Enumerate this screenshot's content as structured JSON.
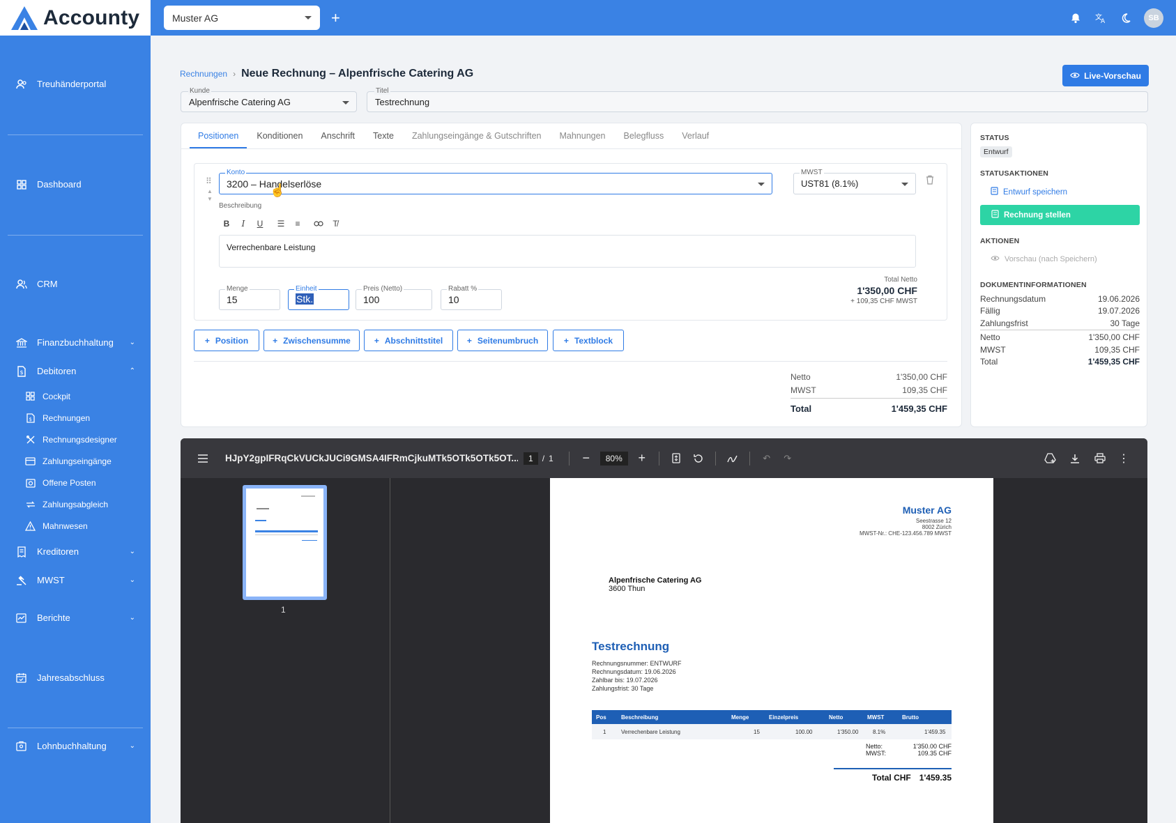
{
  "app": {
    "name": "Accounty"
  },
  "topbar": {
    "company": "Muster AG",
    "avatar": "SB"
  },
  "sidebar": {
    "items": [
      {
        "label": "Treuhänderportal"
      },
      {
        "label": "Dashboard"
      },
      {
        "label": "CRM"
      },
      {
        "label": "Finanzbuchhaltung"
      },
      {
        "label": "Debitoren"
      },
      {
        "label": "Kreditoren"
      },
      {
        "label": "MWST"
      },
      {
        "label": "Berichte"
      },
      {
        "label": "Jahresabschluss"
      },
      {
        "label": "Lohnbuchhaltung"
      }
    ],
    "sub": [
      {
        "label": "Cockpit"
      },
      {
        "label": "Rechnungen"
      },
      {
        "label": "Rechnungsdesigner"
      },
      {
        "label": "Zahlungseingänge"
      },
      {
        "label": "Offene Posten"
      },
      {
        "label": "Zahlungsabgleich"
      },
      {
        "label": "Mahnwesen"
      }
    ]
  },
  "header": {
    "crumb": "Rechnungen",
    "title": "Neue Rechnung – Alpenfrische Catering AG",
    "live_preview": "Live-Vorschau"
  },
  "form": {
    "kunde_label": "Kunde",
    "kunde": "Alpenfrische Catering AG",
    "titel_label": "Titel",
    "titel": "Testrechnung"
  },
  "tabs": [
    "Positionen",
    "Konditionen",
    "Anschrift",
    "Texte",
    "Zahlungseingänge & Gutschriften",
    "Mahnungen",
    "Belegfluss",
    "Verlauf"
  ],
  "position": {
    "konto_label": "Konto",
    "konto": "3200 – Handelserlöse",
    "mwst_label": "MWST",
    "mwst": "UST81 (8.1%)",
    "beschreibung_label": "Beschreibung",
    "beschreibung": "Verrechenbare Leistung",
    "menge_label": "Menge",
    "menge": "15",
    "einheit_label": "Einheit",
    "einheit": "Stk.",
    "preis_label": "Preis (Netto)",
    "preis": "100",
    "rabatt_label": "Rabatt %",
    "rabatt": "10",
    "total_label": "Total Netto",
    "total": "1'350,00 CHF",
    "total_mwst": "+ 109,35 CHF MWST"
  },
  "add_buttons": [
    "Position",
    "Zwischensumme",
    "Abschnittstitel",
    "Seitenumbruch",
    "Textblock"
  ],
  "summary": {
    "netto_label": "Netto",
    "netto": "1'350,00 CHF",
    "mwst_label": "MWST",
    "mwst": "109,35 CHF",
    "total_label": "Total",
    "total": "1'459,35 CHF"
  },
  "status": {
    "status_h": "STATUS",
    "badge": "Entwurf",
    "statusaktionen_h": "STATUSAKTIONEN",
    "save": "Entwurf speichern",
    "create": "Rechnung stellen",
    "aktionen_h": "AKTIONEN",
    "preview": "Vorschau (nach Speichern)",
    "doc_h": "DOKUMENTINFORMATIONEN",
    "rows": [
      {
        "k": "Rechnungsdatum",
        "v": "19.06.2026"
      },
      {
        "k": "Fällig",
        "v": "19.07.2026"
      },
      {
        "k": "Zahlungsfrist",
        "v": "30 Tage"
      },
      {
        "k": "Netto",
        "v": "1'350,00 CHF"
      },
      {
        "k": "MWST",
        "v": "109,35 CHF"
      },
      {
        "k": "Total",
        "v": "1'459,35 CHF"
      }
    ]
  },
  "pdf": {
    "filename": "HJpY2gpIFRqCkVUCkJUCi9GMSA4IFRmCjkuMTk5OTk5OTk5OT...",
    "page": "1",
    "pages": "1",
    "zoom": "80%",
    "thumb_label": "1",
    "doc": {
      "company": "Muster AG",
      "addr1": "Seestrasse 12",
      "addr2": "8002 Zürich",
      "vat": "MWST-Nr.: CHE-123.456.789 MWST",
      "cust1": "Alpenfrische Catering AG",
      "cust2": "3600 Thun",
      "title": "Testrechnung",
      "meta": [
        "Rechnungsnummer: ENTWURF",
        "Rechnungsdatum: 19.06.2026",
        "Zahlbar bis: 19.07.2026",
        "Zahlungsfrist: 30 Tage"
      ],
      "cols": [
        "Pos",
        "Beschreibung",
        "Menge",
        "Einzelpreis",
        "Netto",
        "MWST",
        "Brutto"
      ],
      "row": [
        "1",
        "Verrechenbare Leistung",
        "15",
        "100.00",
        "1'350.00",
        "8.1%",
        "1'459.35"
      ],
      "netto_label": "Netto:",
      "netto": "1'350.00 CHF",
      "mwst_label": "MWST:",
      "mwst": "109.35 CHF",
      "total_label": "Total CHF",
      "total": "1'459.35"
    }
  },
  "colors": {
    "primary": "#3a82e4",
    "accent": "#2f7be5",
    "success": "#2dd4a5"
  }
}
